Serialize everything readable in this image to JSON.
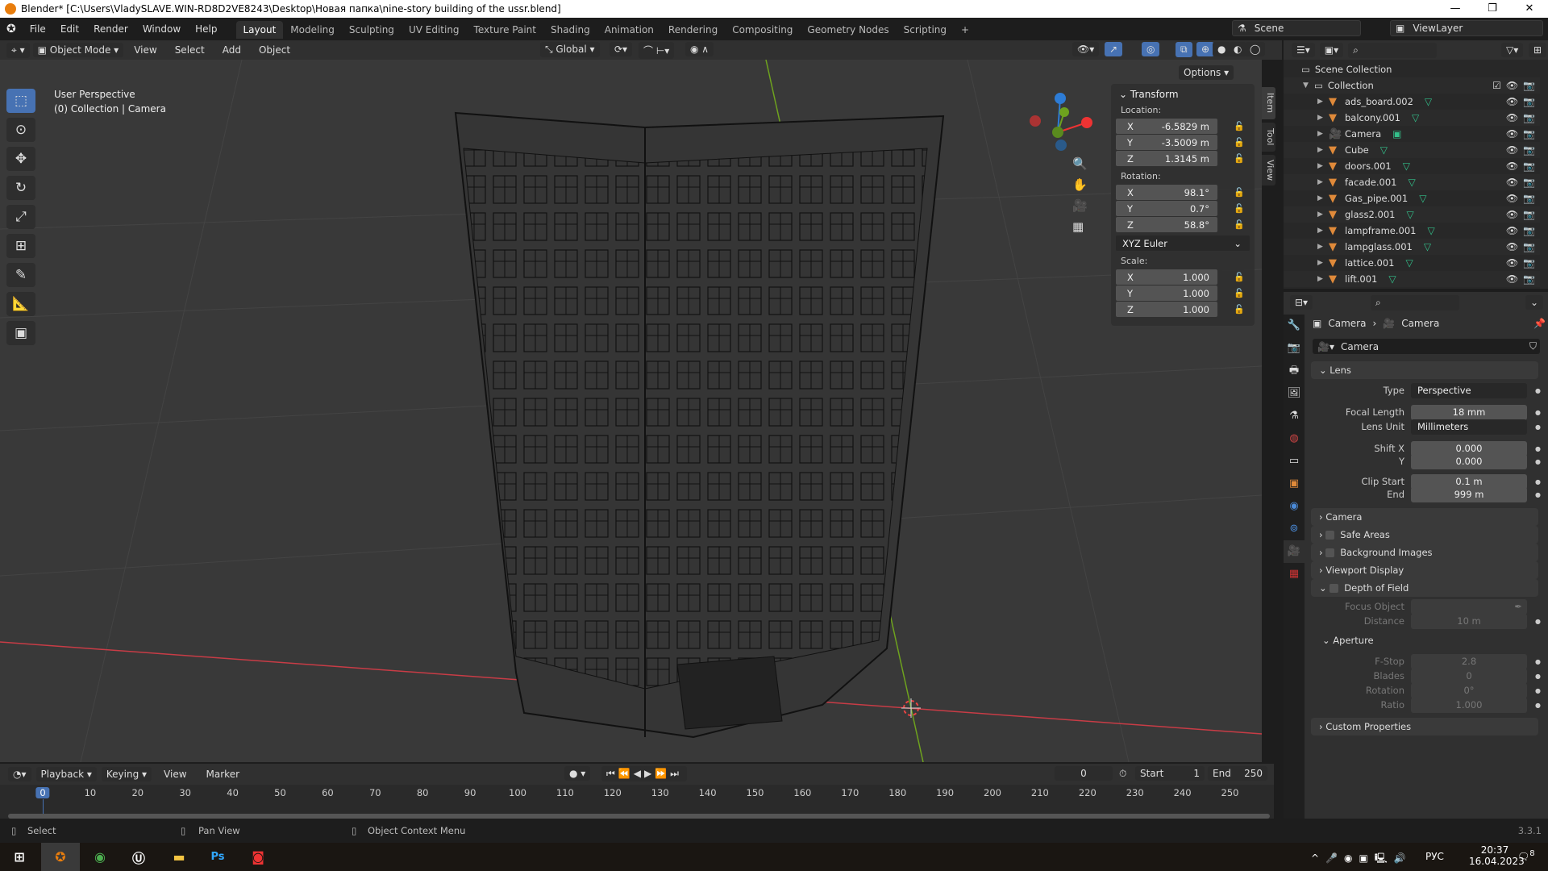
{
  "window": {
    "title": "Blender* [C:\\Users\\VladySLAVE.WIN-RD8D2VE8243\\Desktop\\Новая папка\\nine-story building of the ussr.blend]"
  },
  "menu": [
    "File",
    "Edit",
    "Render",
    "Window",
    "Help"
  ],
  "workspaces": [
    "Layout",
    "Modeling",
    "Sculpting",
    "UV Editing",
    "Texture Paint",
    "Shading",
    "Animation",
    "Rendering",
    "Compositing",
    "Geometry Nodes",
    "Scripting",
    "+"
  ],
  "scene": {
    "name": "Scene",
    "view_layer": "ViewLayer"
  },
  "viewport_header": {
    "mode": "Object Mode",
    "menus": [
      "View",
      "Select",
      "Add",
      "Object"
    ],
    "orientation": "Global",
    "options": "Options"
  },
  "viewport": {
    "perspective": "User Perspective",
    "context": "(0) Collection | Camera"
  },
  "transform": {
    "title": "Transform",
    "location_label": "Location:",
    "rotation_label": "Rotation:",
    "scale_label": "Scale:",
    "location": [
      {
        "axis": "X",
        "value": "-6.5829 m"
      },
      {
        "axis": "Y",
        "value": "-3.5009 m"
      },
      {
        "axis": "Z",
        "value": "1.3145 m"
      }
    ],
    "rotation": [
      {
        "axis": "X",
        "value": "98.1°"
      },
      {
        "axis": "Y",
        "value": "0.7°"
      },
      {
        "axis": "Z",
        "value": "58.8°"
      }
    ],
    "rotation_mode": "XYZ Euler",
    "scale": [
      {
        "axis": "X",
        "value": "1.000"
      },
      {
        "axis": "Y",
        "value": "1.000"
      },
      {
        "axis": "Z",
        "value": "1.000"
      }
    ]
  },
  "side_tabs": [
    "Item",
    "Tool",
    "View"
  ],
  "outliner": {
    "root": "Scene Collection",
    "collection": "Collection",
    "items": [
      "ads_board.002",
      "balcony.001",
      "Camera",
      "Cube",
      "doors.001",
      "facade.001",
      "Gas_pipe.001",
      "glass2.001",
      "lampframe.001",
      "lampglass.001",
      "lattice.001",
      "lift.001"
    ]
  },
  "properties": {
    "breadcrumb": [
      "Camera",
      "Camera"
    ],
    "datablock": "Camera",
    "lens": {
      "title": "Lens",
      "type_label": "Type",
      "type": "Perspective",
      "focal_label": "Focal Length",
      "focal": "18 mm",
      "unit_label": "Lens Unit",
      "unit": "Millimeters",
      "shiftx_label": "Shift X",
      "shiftx": "0.000",
      "shifty_label": "Y",
      "shifty": "0.000",
      "clipstart_label": "Clip Start",
      "clipstart": "0.1 m",
      "clipend_label": "End",
      "clipend": "999 m"
    },
    "sections": [
      "Camera",
      "Safe Areas",
      "Background Images",
      "Viewport Display",
      "Depth of Field"
    ],
    "dof": {
      "focus_label": "Focus Object",
      "distance_label": "Distance",
      "distance": "10 m",
      "aperture": "Aperture",
      "fstop_label": "F-Stop",
      "fstop": "2.8",
      "blades_label": "Blades",
      "blades": "0",
      "rotation_label": "Rotation",
      "rotation": "0°",
      "ratio_label": "Ratio",
      "ratio": "1.000"
    },
    "custom": "Custom Properties"
  },
  "timeline": {
    "menus": [
      "Playback",
      "Keying",
      "View",
      "Marker"
    ],
    "current": "0",
    "start_label": "Start",
    "start": "1",
    "end_label": "End",
    "end": "250",
    "ticks": [
      "0",
      "10",
      "20",
      "30",
      "40",
      "50",
      "60",
      "70",
      "80",
      "90",
      "100",
      "110",
      "120",
      "130",
      "140",
      "150",
      "160",
      "170",
      "180",
      "190",
      "200",
      "210",
      "220",
      "230",
      "240",
      "250"
    ]
  },
  "status": {
    "select": "Select",
    "pan": "Pan View",
    "context": "Object Context Menu",
    "version": "3.3.1"
  },
  "taskbar": {
    "lang": "РУС",
    "time": "20:37",
    "date": "16.04.2023",
    "notifications": "8"
  },
  "colors": {
    "accent": "#4772b3",
    "mesh": "#e08a3a",
    "data": "#33c08a",
    "x_axis": "#c83c46",
    "y_axis": "#6ea21e"
  }
}
